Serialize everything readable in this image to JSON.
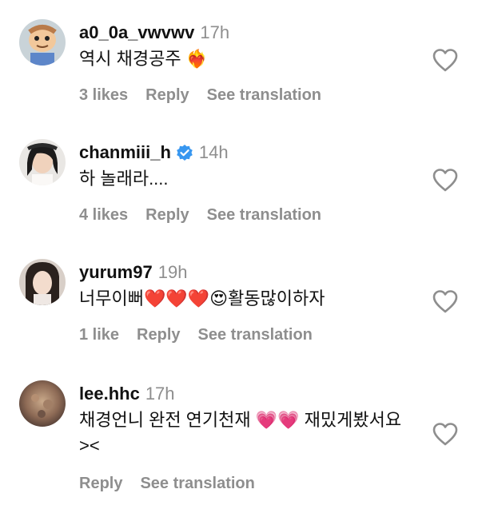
{
  "comments": [
    {
      "username": "a0_0a_vwvwv",
      "time": "17h",
      "text": "역시 채경공주 ❤️‍🔥",
      "likes": "3 likes",
      "reply": "Reply",
      "translate": "See translation",
      "verified": false
    },
    {
      "username": "chanmiii_h",
      "time": "14h",
      "text": "하 놀래라....",
      "likes": "4 likes",
      "reply": "Reply",
      "translate": "See translation",
      "verified": true
    },
    {
      "username": "yurum97",
      "time": "19h",
      "text": "너무이뻐❤️❤️❤️😍활동많이하자",
      "likes": "1 like",
      "reply": "Reply",
      "translate": "See translation",
      "verified": false
    },
    {
      "username": "lee.hhc",
      "time": "17h",
      "text": "채경언니 완전 연기천재 💗💗 재밌게봤서요\n><",
      "likes": "",
      "reply": "Reply",
      "translate": "See translation",
      "verified": false
    }
  ],
  "colors": {
    "text": "#111111",
    "muted": "#8e8e8e",
    "verified": "#3897f0",
    "heart_outline": "#8e8e8e"
  },
  "icons": {
    "like": "heart-outline-icon",
    "verified": "verified-badge-icon"
  }
}
